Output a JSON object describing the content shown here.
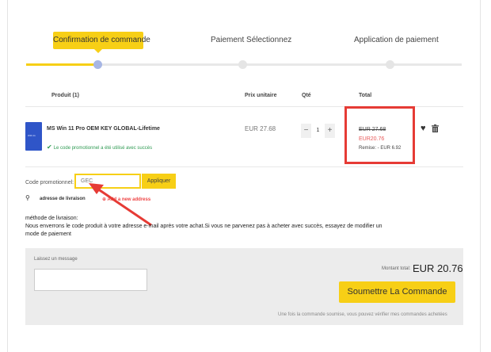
{
  "steps": [
    {
      "label": "Confirmation de commande",
      "active": true
    },
    {
      "label": "Paiement Sélectionnez",
      "active": false
    },
    {
      "label": "Application de paiement",
      "active": false
    }
  ],
  "progress": {
    "completed_fraction": 0.17
  },
  "table": {
    "headers": {
      "product": "Produit (1)",
      "unit_price": "Prix unitaire",
      "qty": "Qté",
      "total": "Total"
    }
  },
  "product": {
    "name": "MS Win 11 Pro OEM KEY GLOBAL-Lifetime",
    "promo_success": "Le code promotionnel a été utilisé avec succès",
    "unit_price": "EUR 27.68",
    "qty": "1",
    "qty_minus": "−",
    "qty_plus": "+",
    "old_total": "EUR 27.68",
    "new_total": "EUR20.76",
    "discount": "Remise: - EUR 6.92"
  },
  "promo": {
    "label": "Code promotionnel:",
    "value": "GEC",
    "apply_label": "Appliquer"
  },
  "address": {
    "label": "adresse de livraison",
    "add_label": "Add a new address"
  },
  "delivery": {
    "title": "méthode de livraison:",
    "text": "Nous enverrons le code produit à votre adresse e-mail après votre achat.Si vous ne parvenez pas à acheter avec succès, essayez de modifier un mode de paiement"
  },
  "message": {
    "label": "Laissez un message",
    "placeholder": ""
  },
  "total": {
    "label": "Montant total:",
    "value": "EUR 20.76"
  },
  "submit_label": "Soumettre La Commande",
  "note": "Une fois la commande soumise, vous pouvez vérifier mes commandes achetées",
  "colors": {
    "accent": "#f7cf16",
    "highlight": "#e63b35",
    "success": "#2e9a52",
    "price_new": "#e85a5a"
  },
  "icons": [
    "check-icon",
    "heart-icon",
    "trash-icon",
    "location-pin-icon",
    "add-icon",
    "arrow-annotation"
  ]
}
